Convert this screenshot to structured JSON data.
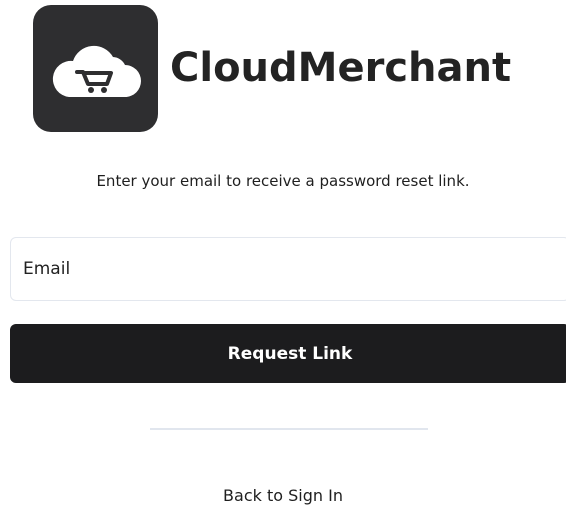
{
  "brand": {
    "name": "CloudMerchant",
    "logo_icon": "cloud-cart-icon",
    "logo_bg_color": "#2e2e30"
  },
  "instructions": "Enter your email to receive a password reset link.",
  "email_field": {
    "placeholder": "Email",
    "value": ""
  },
  "request_button": {
    "label": "Request Link",
    "bg_color": "#1c1c1e",
    "text_color": "#ffffff"
  },
  "back_link": {
    "label": "Back to Sign In"
  }
}
